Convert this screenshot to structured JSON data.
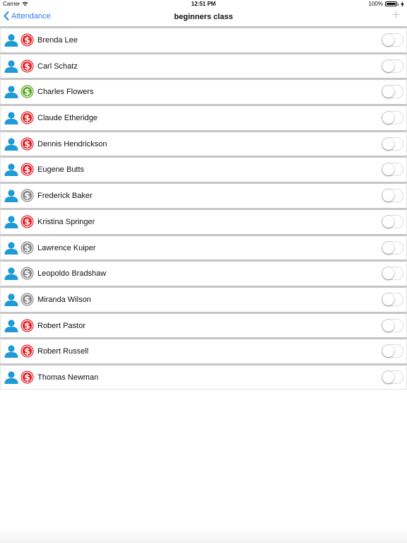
{
  "status_bar": {
    "carrier": "Carrier",
    "wifi_icon": "wifi-icon",
    "time": "12:51 PM",
    "battery_percent": "100%",
    "battery_level": 1.0,
    "charging_icon": "bolt-icon"
  },
  "nav": {
    "back_label": "Attendance",
    "title": "beginners class",
    "add_icon": "plus-icon"
  },
  "colors": {
    "accent": "#2b7cf6",
    "person_icon": "#1e9ad6",
    "status_red": "#e3232b",
    "status_green": "#5aa91f",
    "status_gray": "#8a8a8a"
  },
  "students": [
    {
      "name": "Brenda Lee",
      "status": "red",
      "present": false
    },
    {
      "name": "Carl Schatz",
      "status": "red",
      "present": false
    },
    {
      "name": "Charles Flowers",
      "status": "green",
      "present": false
    },
    {
      "name": "Claude Etheridge",
      "status": "red",
      "present": false
    },
    {
      "name": "Dennis Hendrickson",
      "status": "red",
      "present": false
    },
    {
      "name": "Eugene Butts",
      "status": "red",
      "present": false
    },
    {
      "name": "Frederick Baker",
      "status": "gray",
      "present": false
    },
    {
      "name": "Kristina Springer",
      "status": "red",
      "present": false
    },
    {
      "name": "Lawrence Kuiper",
      "status": "gray",
      "present": false
    },
    {
      "name": "Leopoldo Bradshaw",
      "status": "gray",
      "present": false
    },
    {
      "name": "Miranda Wilson",
      "status": "gray",
      "present": false
    },
    {
      "name": "Robert Pastor",
      "status": "red",
      "present": false
    },
    {
      "name": "Robert Russell",
      "status": "red",
      "present": false
    },
    {
      "name": "Thomas Newman",
      "status": "red",
      "present": false
    }
  ]
}
